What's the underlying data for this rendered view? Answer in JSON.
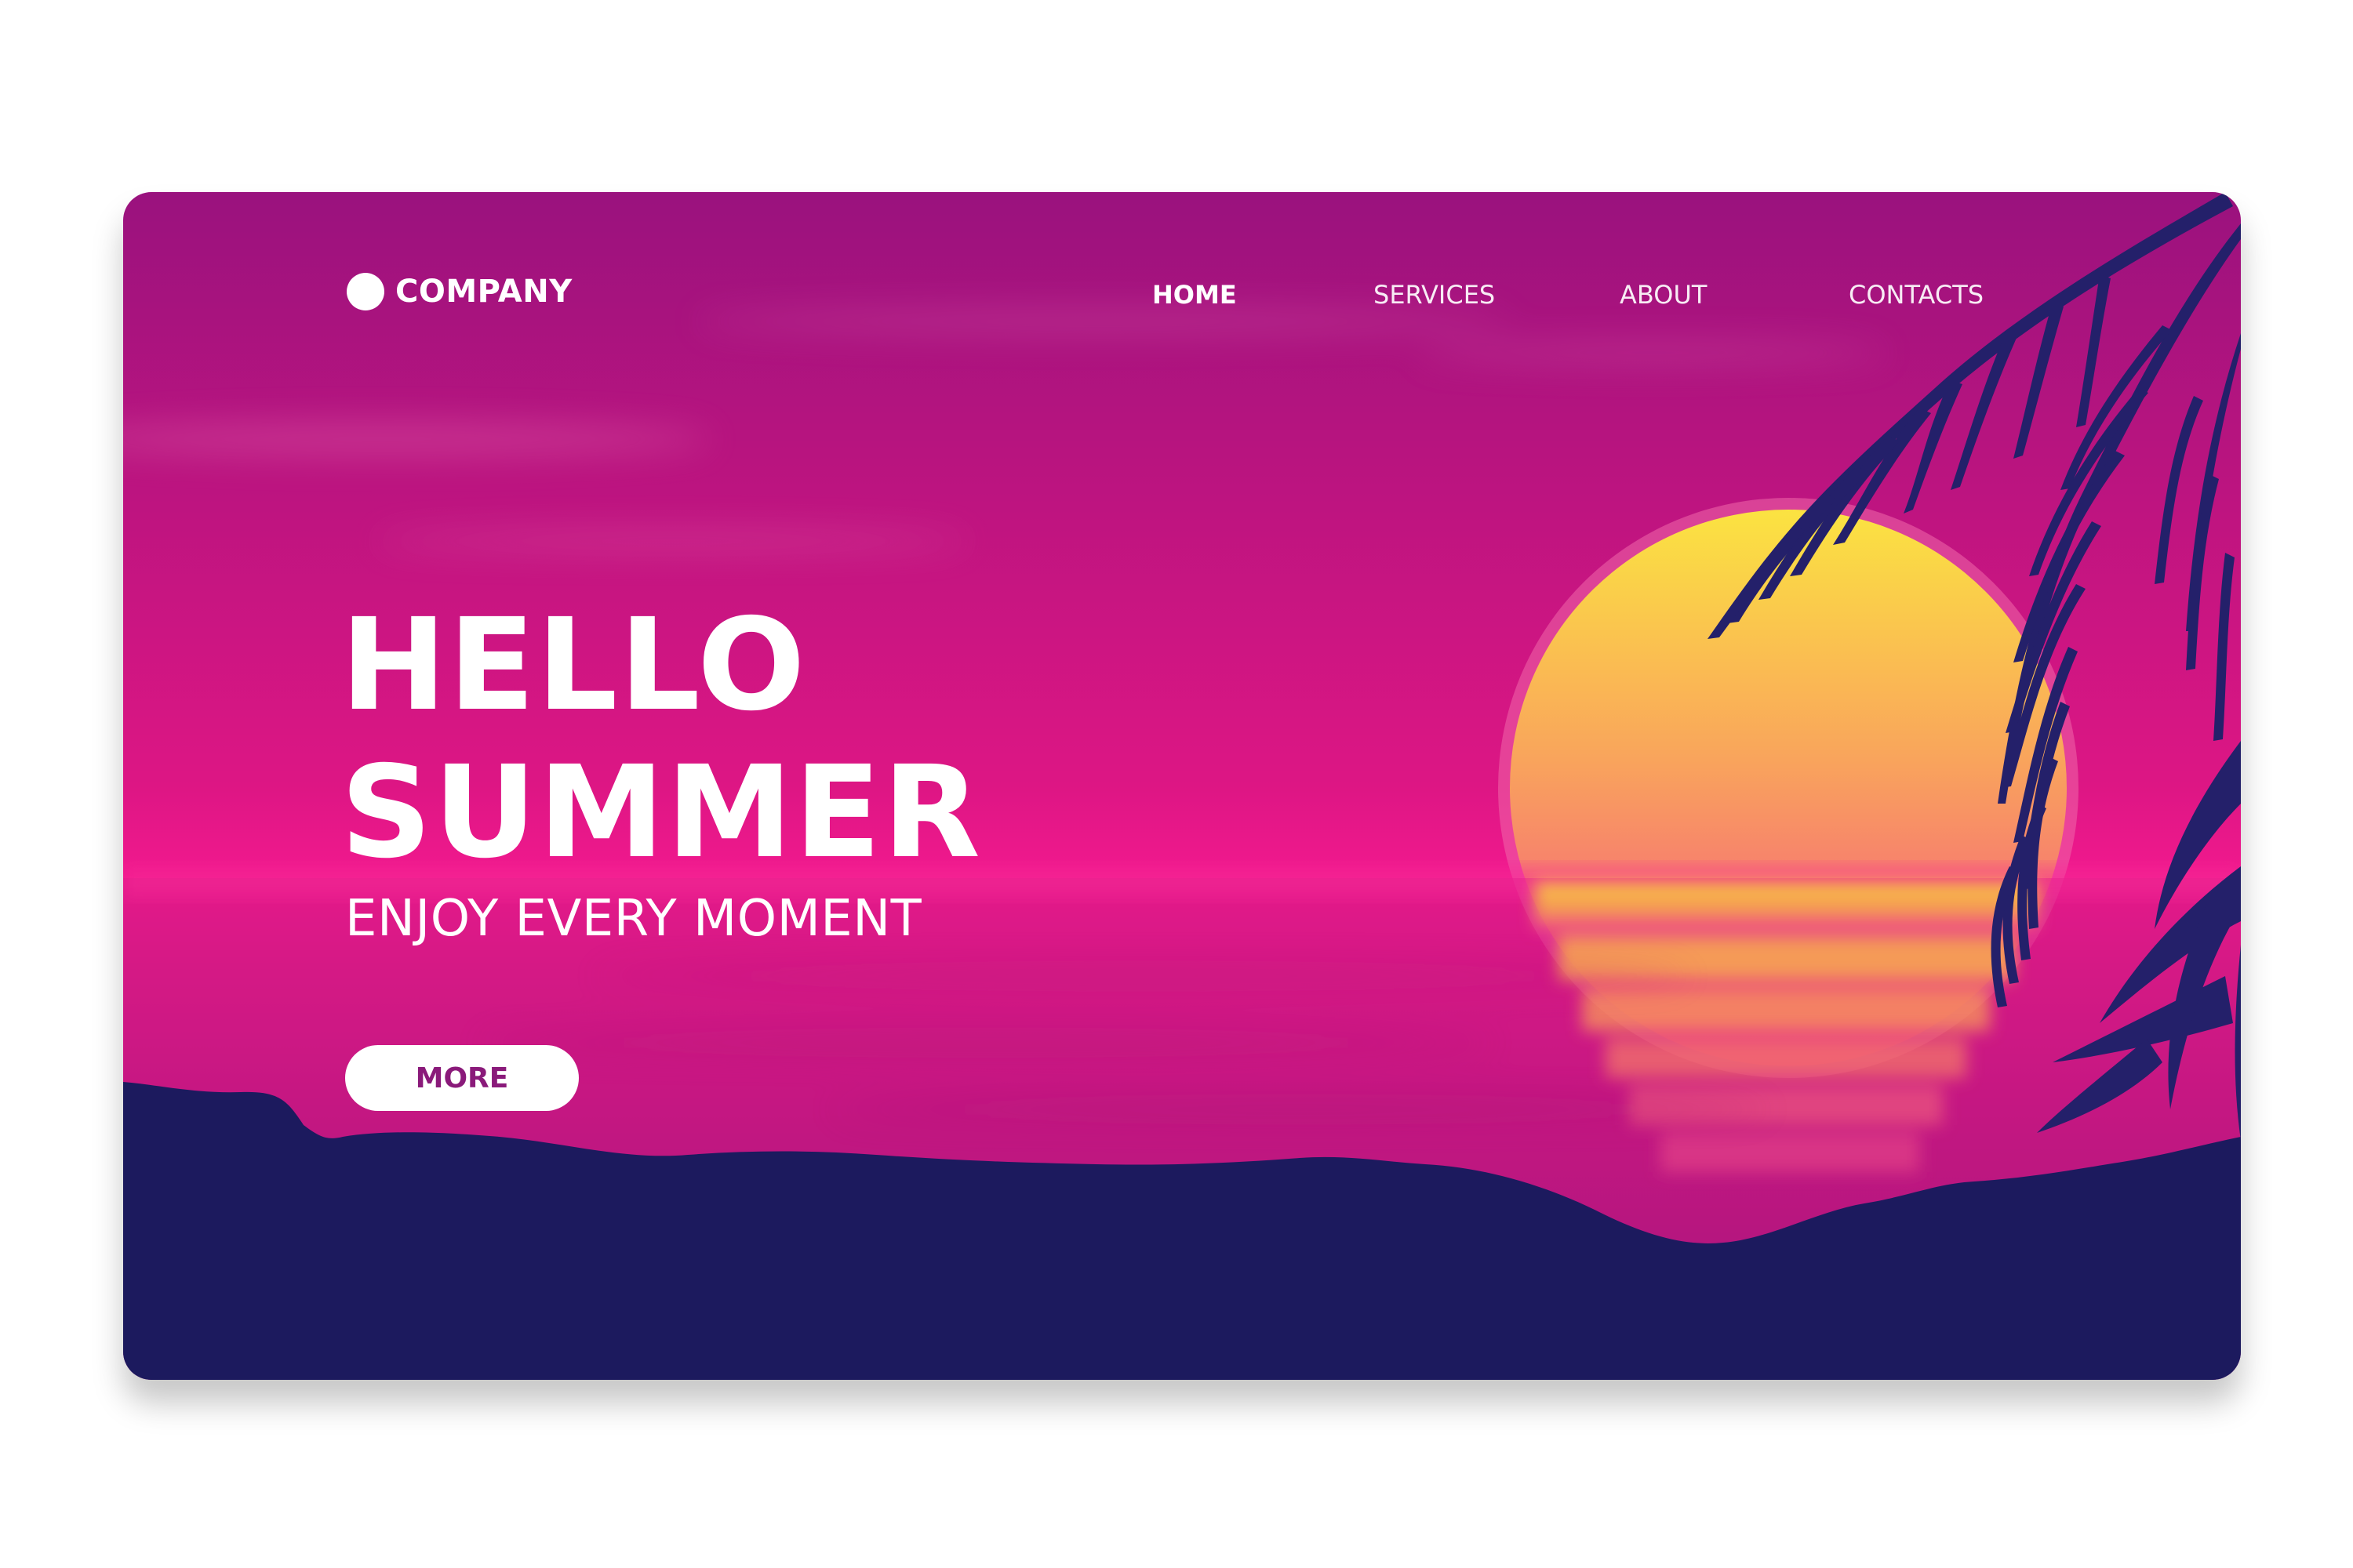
{
  "header": {
    "brand_name": "COMPANY",
    "nav": {
      "home": "HOME",
      "services": "SERVICES",
      "about": "ABOUT",
      "contacts": "CONTACTS"
    }
  },
  "hero": {
    "title_line1": "HELLO",
    "title_line2": "SUMMER",
    "subtitle": "ENJOY EVERY MOMENT",
    "cta_label": "MORE"
  },
  "colors": {
    "sky_top": "#9a127e",
    "horizon": "#f2198e",
    "sun": "#fbe341",
    "silhouette": "#1c1a5e",
    "button_text": "#8a1a7a"
  }
}
